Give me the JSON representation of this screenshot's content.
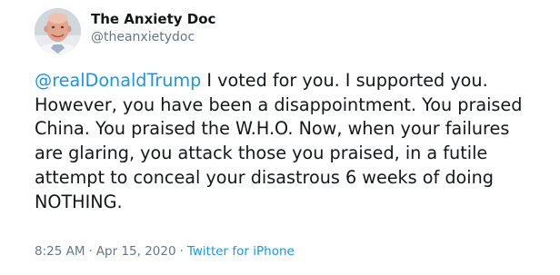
{
  "author": {
    "display_name": "The Anxiety Doc",
    "handle": "@theanxietydoc"
  },
  "tweet": {
    "mention": "@realDonaldTrump",
    "line1_rest": " I voted for you. I supported you.",
    "line2": "However, you have been a disappointment. You praised",
    "line3": "China. You praised the W.H.O.  Now, when your failures",
    "line4": "are glaring, you attack those you praised, in a futile",
    "line5": "attempt to conceal your disastrous 6 weeks of doing",
    "line6": "NOTHING."
  },
  "meta": {
    "time": "8:25 AM",
    "separator": "·",
    "date": "Apr 15, 2020",
    "separator2": "·",
    "source": "Twitter for iPhone"
  },
  "colors": {
    "link": "#1b95e0",
    "secondary_text": "#657786",
    "primary_text": "#14171a"
  }
}
